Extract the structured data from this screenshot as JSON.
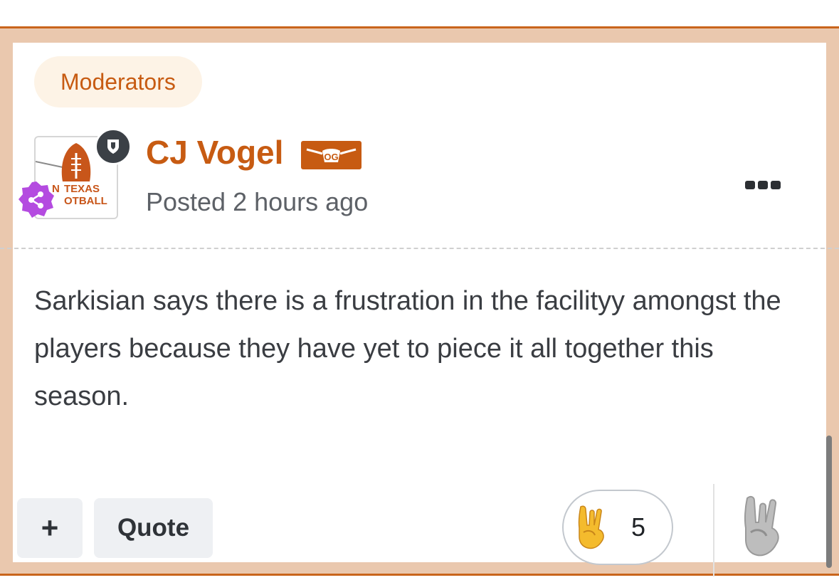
{
  "post": {
    "group_label": "Moderators",
    "author_name": "CJ Vogel",
    "author_badge": "OG",
    "avatar_text_line1": "TEXAS",
    "avatar_text_line2": "OTBALL",
    "avatar_text_line1_prefix": "N",
    "posted_label": "Posted 2 hours ago",
    "body": "Sarkisian says there is a frustration in the facilityy amongst the players because they have yet to piece it all together this season.",
    "more_icon": "ellipsis-icon"
  },
  "actions": {
    "plus_label": "+",
    "quote_label": "Quote"
  },
  "reactions": {
    "current_icon": "rock-on-hand-icon",
    "count": "5",
    "add_icon": "rock-on-hand-outline-icon"
  },
  "colors": {
    "accent": "#c75b12",
    "frame": "#eac8ae",
    "frame_border": "#c9651c",
    "pill_bg": "#fdf3e6",
    "share_badge": "#b44be0"
  }
}
